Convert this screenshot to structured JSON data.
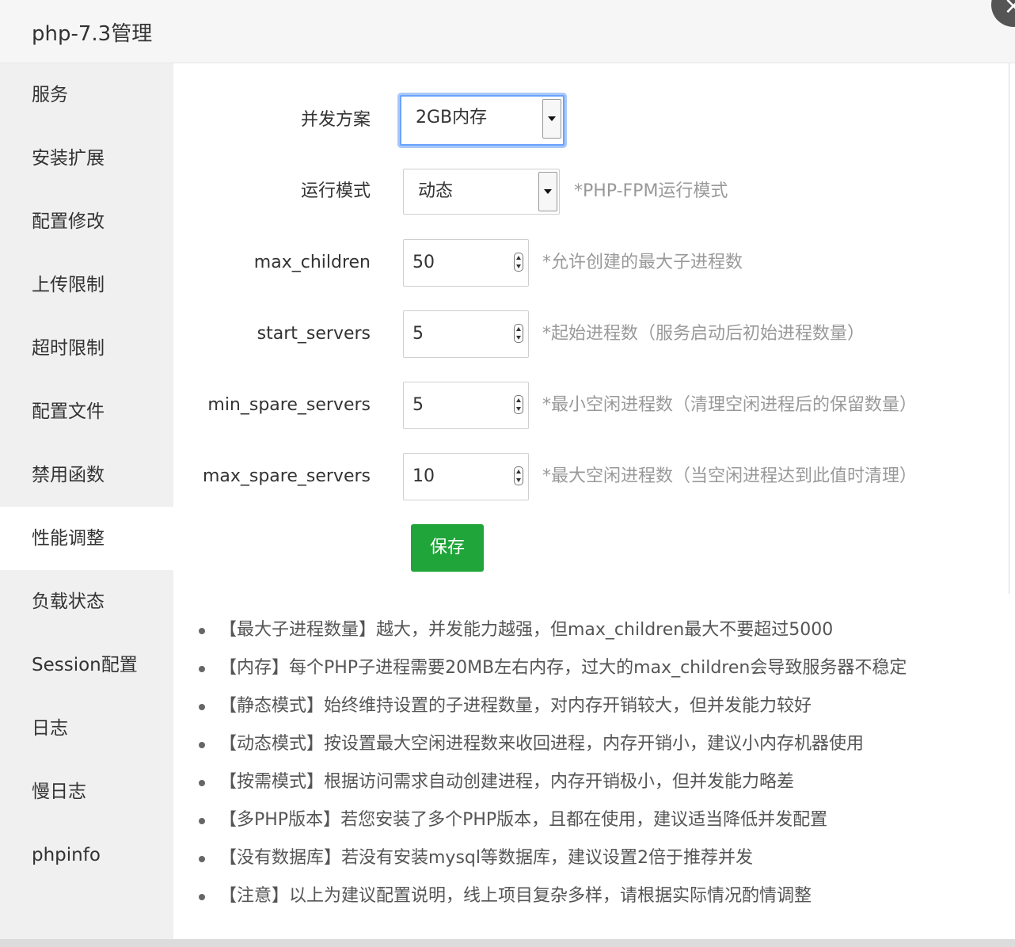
{
  "window": {
    "title": "php-7.3管理"
  },
  "sidebar": {
    "items": [
      {
        "label": "服务",
        "active": false
      },
      {
        "label": "安装扩展",
        "active": false
      },
      {
        "label": "配置修改",
        "active": false
      },
      {
        "label": "上传限制",
        "active": false
      },
      {
        "label": "超时限制",
        "active": false
      },
      {
        "label": "配置文件",
        "active": false
      },
      {
        "label": "禁用函数",
        "active": false
      },
      {
        "label": "性能调整",
        "active": true
      },
      {
        "label": "负载状态",
        "active": false
      },
      {
        "label": "Session配置",
        "active": false
      },
      {
        "label": "日志",
        "active": false
      },
      {
        "label": "慢日志",
        "active": false
      },
      {
        "label": "phpinfo",
        "active": false
      }
    ]
  },
  "form": {
    "concurrency": {
      "label": "并发方案",
      "value": "2GB内存"
    },
    "mode": {
      "label": "运行模式",
      "value": "动态",
      "hint": "*PHP-FPM运行模式"
    },
    "max_children": {
      "label": "max_children",
      "value": "50",
      "hint": "*允许创建的最大子进程数"
    },
    "start_servers": {
      "label": "start_servers",
      "value": "5",
      "hint": "*起始进程数（服务启动后初始进程数量）"
    },
    "min_spare_servers": {
      "label": "min_spare_servers",
      "value": "5",
      "hint": "*最小空闲进程数（清理空闲进程后的保留数量）"
    },
    "max_spare_servers": {
      "label": "max_spare_servers",
      "value": "10",
      "hint": "*最大空闲进程数（当空闲进程达到此值时清理）"
    },
    "save_label": "保存"
  },
  "tips": [
    "【最大子进程数量】越大，并发能力越强，但max_children最大不要超过5000",
    "【内存】每个PHP子进程需要20MB左右内存，过大的max_children会导致服务器不稳定",
    "【静态模式】始终维持设置的子进程数量，对内存开销较大，但并发能力较好",
    "【动态模式】按设置最大空闲进程数来收回进程，内存开销小，建议小内存机器使用",
    "【按需模式】根据访问需求自动创建进程，内存开销极小，但并发能力略差",
    "【多PHP版本】若您安装了多个PHP版本，且都在使用，建议适当降低并发配置",
    "【没有数据库】若没有安装mysql等数据库，建议设置2倍于推荐并发",
    "【注意】以上为建议配置说明，线上项目复杂多样，请根据实际情况酌情调整"
  ],
  "icons": {
    "close": "close-icon",
    "select_arrow": "chevron-down-icon",
    "spinner": "spinner-icon"
  }
}
